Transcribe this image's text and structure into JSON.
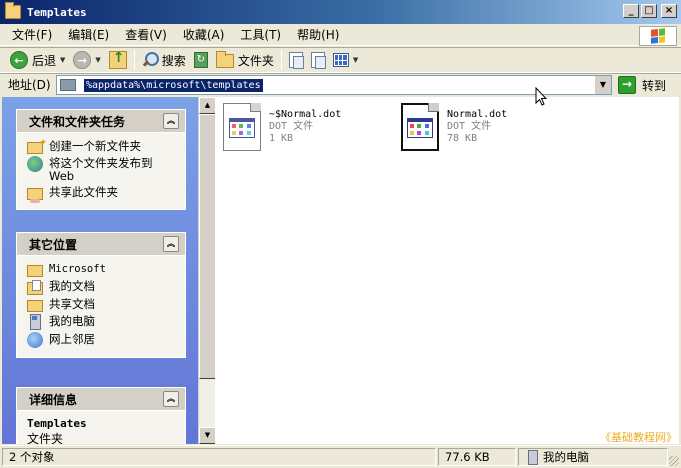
{
  "window": {
    "title": "Templates"
  },
  "menu": {
    "items": [
      "文件(F)",
      "编辑(E)",
      "查看(V)",
      "收藏(A)",
      "工具(T)",
      "帮助(H)"
    ]
  },
  "toolbar": {
    "back_label": "后退",
    "search_label": "搜索",
    "folders_label": "文件夹"
  },
  "address": {
    "label": "地址(D)",
    "value": "%appdata%\\microsoft\\templates",
    "go_label": "转到"
  },
  "tasks_panel": {
    "title": "文件和文件夹任务",
    "items": [
      "创建一个新文件夹",
      "将这个文件夹发布到 Web",
      "共享此文件夹"
    ]
  },
  "places_panel": {
    "title": "其它位置",
    "items": [
      "Microsoft",
      "我的文档",
      "共享文档",
      "我的电脑",
      "网上邻居"
    ]
  },
  "details_panel": {
    "title": "详细信息",
    "name": "Templates",
    "type": "文件夹"
  },
  "files": [
    {
      "name": "~$Normal.dot",
      "type": "DOT 文件",
      "size": "1 KB"
    },
    {
      "name": "Normal.dot",
      "type": "DOT 文件",
      "size": "78 KB"
    }
  ],
  "status": {
    "objects": "2 个对象",
    "size": "77.6 KB",
    "zone": "我的电脑"
  },
  "watermark": "《基础教程网》",
  "colors": {
    "title_start": "#0A246A",
    "title_end": "#A6CAF0",
    "selection": "#0A246A",
    "pane_bg": "#6375D6"
  }
}
